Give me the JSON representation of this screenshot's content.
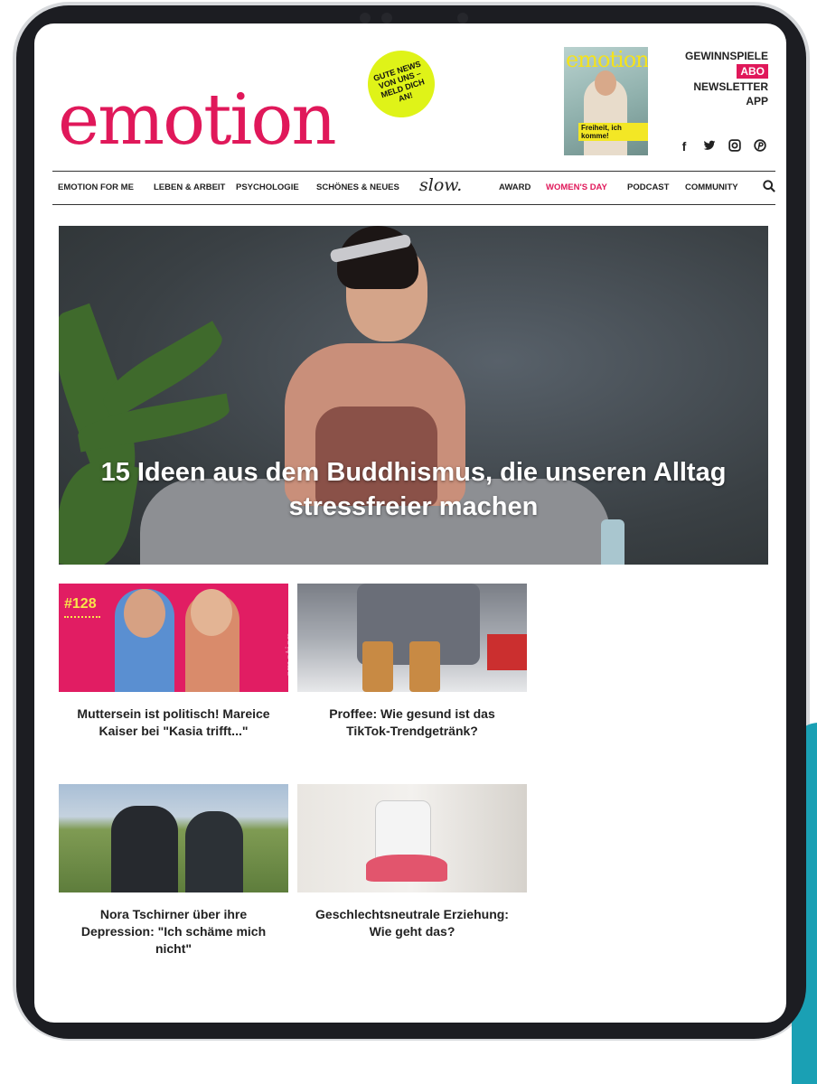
{
  "header": {
    "logo": "emotion",
    "badge_text": "GUTE NEWS VON UNS – MELD DICH AN!",
    "cover": {
      "title": "emotion",
      "tagline": "Freiheit, ich komme!"
    },
    "top_links": [
      "GEWINNSPIELE",
      "ABO",
      "NEWSLETTER",
      "APP"
    ],
    "social": [
      {
        "icon": "facebook-icon",
        "glyph": "f"
      },
      {
        "icon": "twitter-icon",
        "glyph": "🐦"
      },
      {
        "icon": "instagram-icon",
        "glyph": "◙"
      },
      {
        "icon": "pinterest-icon",
        "glyph": "℗"
      }
    ]
  },
  "nav": {
    "items": [
      "EMOTION FOR ME",
      "LEBEN & ARBEIT",
      "PSYCHOLOGIE",
      "SCHÖNES & NEUES",
      "slow.",
      "AWARD",
      "WOMEN'S DAY",
      "PODCAST",
      "COMMUNITY"
    ]
  },
  "hero": {
    "title": "15 Ideen aus dem Buddhismus, die unseren Alltag stressfreier machen"
  },
  "cards": [
    {
      "title": "Muttersein ist politisch! Mareice Kaiser bei \"Kasia trifft...\"",
      "image_text": "#128",
      "image_watermark": "emotion"
    },
    {
      "title": "Proffee: Wie gesund ist das TikTok-Trendgetränk?"
    },
    {
      "title": "Nora Tschirner über ihre Depression: \"Ich schäme mich nicht\""
    },
    {
      "title": "Geschlechtsneutrale Erziehung: Wie geht das?"
    }
  ],
  "colors": {
    "brand": "#e0185a",
    "badge": "#dff318",
    "text": "#222222"
  }
}
